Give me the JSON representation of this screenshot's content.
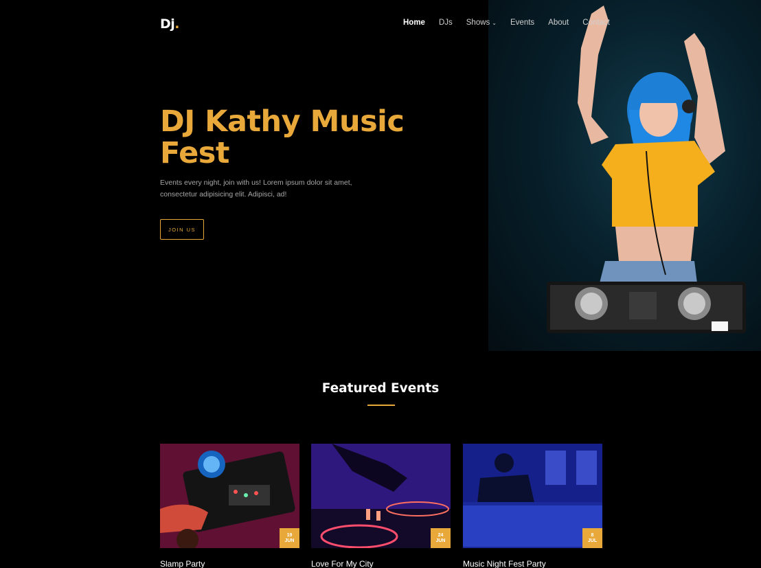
{
  "brand": {
    "logo_text": "Dj",
    "logo_dot": ".",
    "accent": "#e9a93a"
  },
  "nav": {
    "items": [
      {
        "label": "Home",
        "active": true
      },
      {
        "label": "DJs"
      },
      {
        "label": "Shows",
        "dropdown": true
      },
      {
        "label": "Events"
      },
      {
        "label": "About"
      },
      {
        "label": "Contact"
      }
    ]
  },
  "hero": {
    "title": "DJ Kathy Music Fest",
    "description": "Events every night, join with us! Lorem ipsum dolor sit amet, consectetur adipisicing elit. Adipisci, ad!",
    "cta_label": "JOIN US"
  },
  "featured": {
    "title": "Featured Events",
    "events": [
      {
        "name": "Slamp Party",
        "day": "19",
        "month": "JUN"
      },
      {
        "name": "Love For My City",
        "day": "24",
        "month": "JUN"
      },
      {
        "name": "Music Night Fest Party",
        "day": "8",
        "month": "JUL"
      }
    ]
  }
}
